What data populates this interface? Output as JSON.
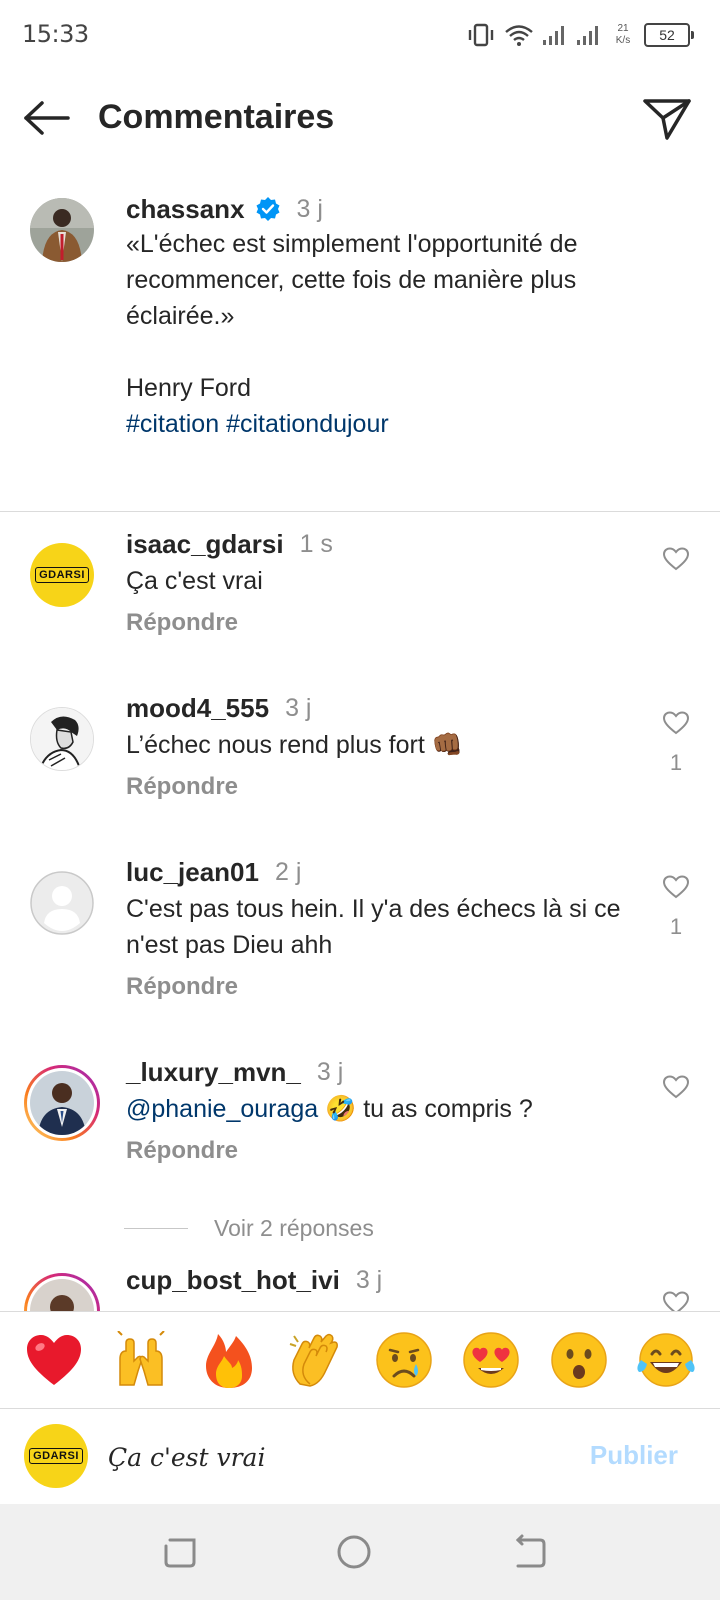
{
  "status_bar": {
    "time": "15:33",
    "net_speed_value": "21",
    "net_speed_unit": "K/s",
    "battery": "52"
  },
  "header": {
    "title": "Commentaires"
  },
  "post": {
    "username": "chassanx",
    "verified": true,
    "time": "3 j",
    "caption": "«L'échec est simplement l'opportunité de recommencer, cette fois de manière plus éclairée.»\n\nHenry Ford\n",
    "hashtags": [
      "#citation",
      "#citationdujour"
    ]
  },
  "comments": [
    {
      "username": "isaac_gdarsi",
      "time": "1 s",
      "text": "Ça c'est vrai",
      "reply": "Répondre",
      "likes": ""
    },
    {
      "username": "mood4_555",
      "time": "3 j",
      "text": "L’échec nous rend plus fort 👊🏾",
      "reply": "Répondre",
      "likes": "1"
    },
    {
      "username": "luc_jean01",
      "time": "2 j",
      "text": "C'est pas tous hein. Il y'a des échecs là si ce n'est pas Dieu ahh",
      "reply": "Répondre",
      "likes": "1"
    },
    {
      "username": "_luxury_mvn_",
      "time": "3 j",
      "mention": "@phanie_ouraga",
      "text": " 🤣 tu as compris ?",
      "reply": "Répondre",
      "likes": ""
    },
    {
      "username": "cup_bost_hot_ivi",
      "time": "3 j"
    }
  ],
  "view_replies": "Voir 2 réponses",
  "avatar_logo_text": "GDARSI",
  "emoji_bar": [
    "heart",
    "raising-hands",
    "fire",
    "clapping-hands",
    "crying-face",
    "heart-eyes",
    "surprised-face",
    "tears-of-joy"
  ],
  "input": {
    "value": "Ça c'est vrai",
    "publish_label": "Publier"
  },
  "colors": {
    "link": "#00376b",
    "secondary": "#8e8e8e",
    "verified": "#0095f6",
    "publish_disabled": "#b3dbff",
    "story_ring": "#d62976"
  }
}
